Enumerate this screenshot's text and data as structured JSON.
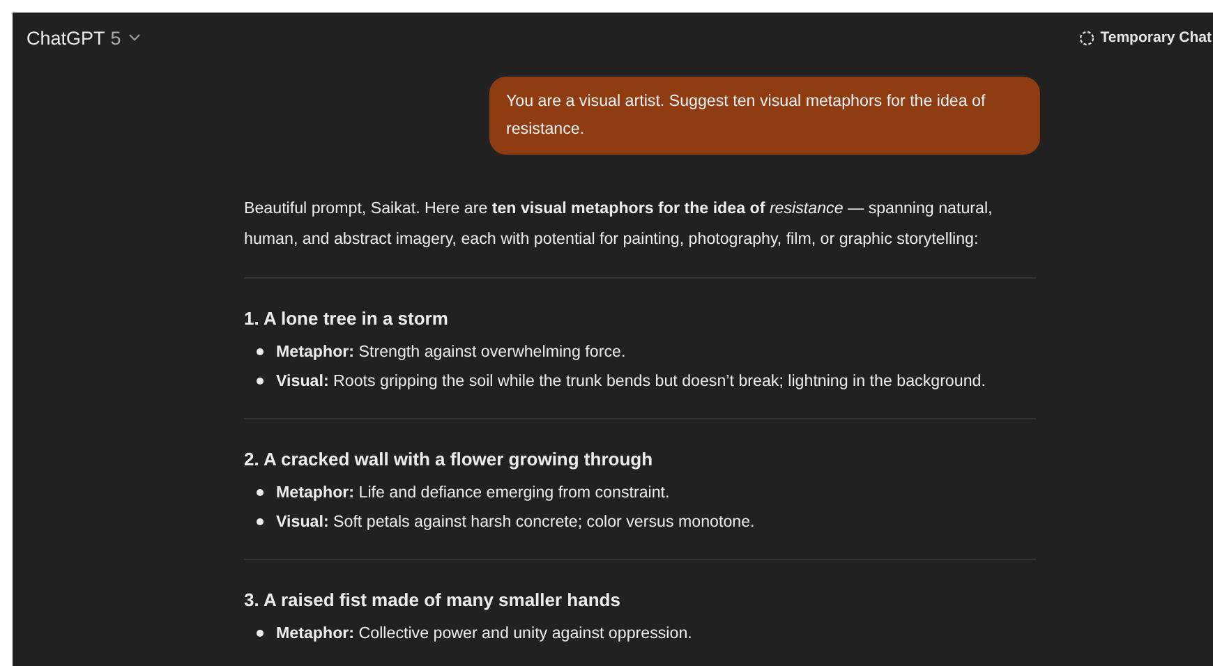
{
  "header": {
    "model": "ChatGPT",
    "version": "5",
    "temporary_chat": "Temporary Chat"
  },
  "user_message": "You are a visual artist. Suggest ten visual metaphors for the idea of resistance.",
  "reply_intro": "Beautiful prompt, Saikat. Here are **ten visual metaphors for the idea of** *resistance* — spanning natural, human, and abstract imagery, each with potential for painting, photography, film, or graphic storytelling:",
  "sections": [
    {
      "heading": "1. A lone tree in a storm",
      "bullets": [
        "**Metaphor:** Strength against overwhelming force.",
        "**Visual:** Roots gripping the soil while the trunk bends but doesn’t break; lightning in the background."
      ]
    },
    {
      "heading": "2. A cracked wall with a flower growing through",
      "bullets": [
        "**Metaphor:** Life and defiance emerging from constraint.",
        "**Visual:** Soft petals against harsh concrete; color versus monotone."
      ]
    },
    {
      "heading": "3. A raised fist made of many smaller hands",
      "bullets": [
        "**Metaphor:** Collective power and unity against oppression."
      ]
    }
  ]
}
